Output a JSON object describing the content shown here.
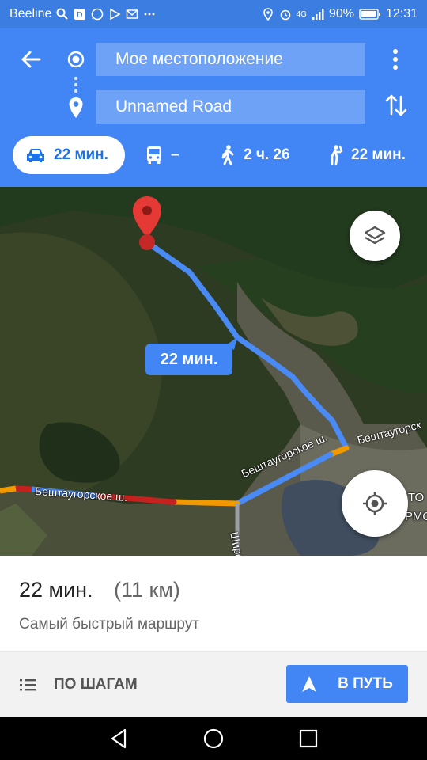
{
  "status_bar": {
    "carrier": "Beeline",
    "network": "4G",
    "battery": "90%",
    "time": "12:31"
  },
  "route": {
    "origin": "Мое местоположение",
    "destination": "Unnamed Road"
  },
  "modes": {
    "drive": "22 мин.",
    "transit": "–",
    "walk": "2 ч. 26",
    "ride": "22 мин."
  },
  "map": {
    "time_bubble": "22 мин.",
    "road_labels": {
      "beshtau_left": "Бештаугорское ш.",
      "beshtau_mid": "Бештаугорское ш.",
      "beshtau_right": "Бештаугорск",
      "shiro": "Широ",
      "partial_1": "ТО",
      "partial_2": "РМО"
    }
  },
  "summary": {
    "time": "22 мин.",
    "distance": "(11 км)",
    "description": "Самый быстрый маршрут"
  },
  "actions": {
    "steps_label": "ПО ШАГАМ",
    "go_label": "В ПУТЬ"
  },
  "colors": {
    "header": "#4285f4",
    "route": "#4a8af4",
    "traffic_slow": "#f29900",
    "traffic_jam": "#c5221f"
  }
}
